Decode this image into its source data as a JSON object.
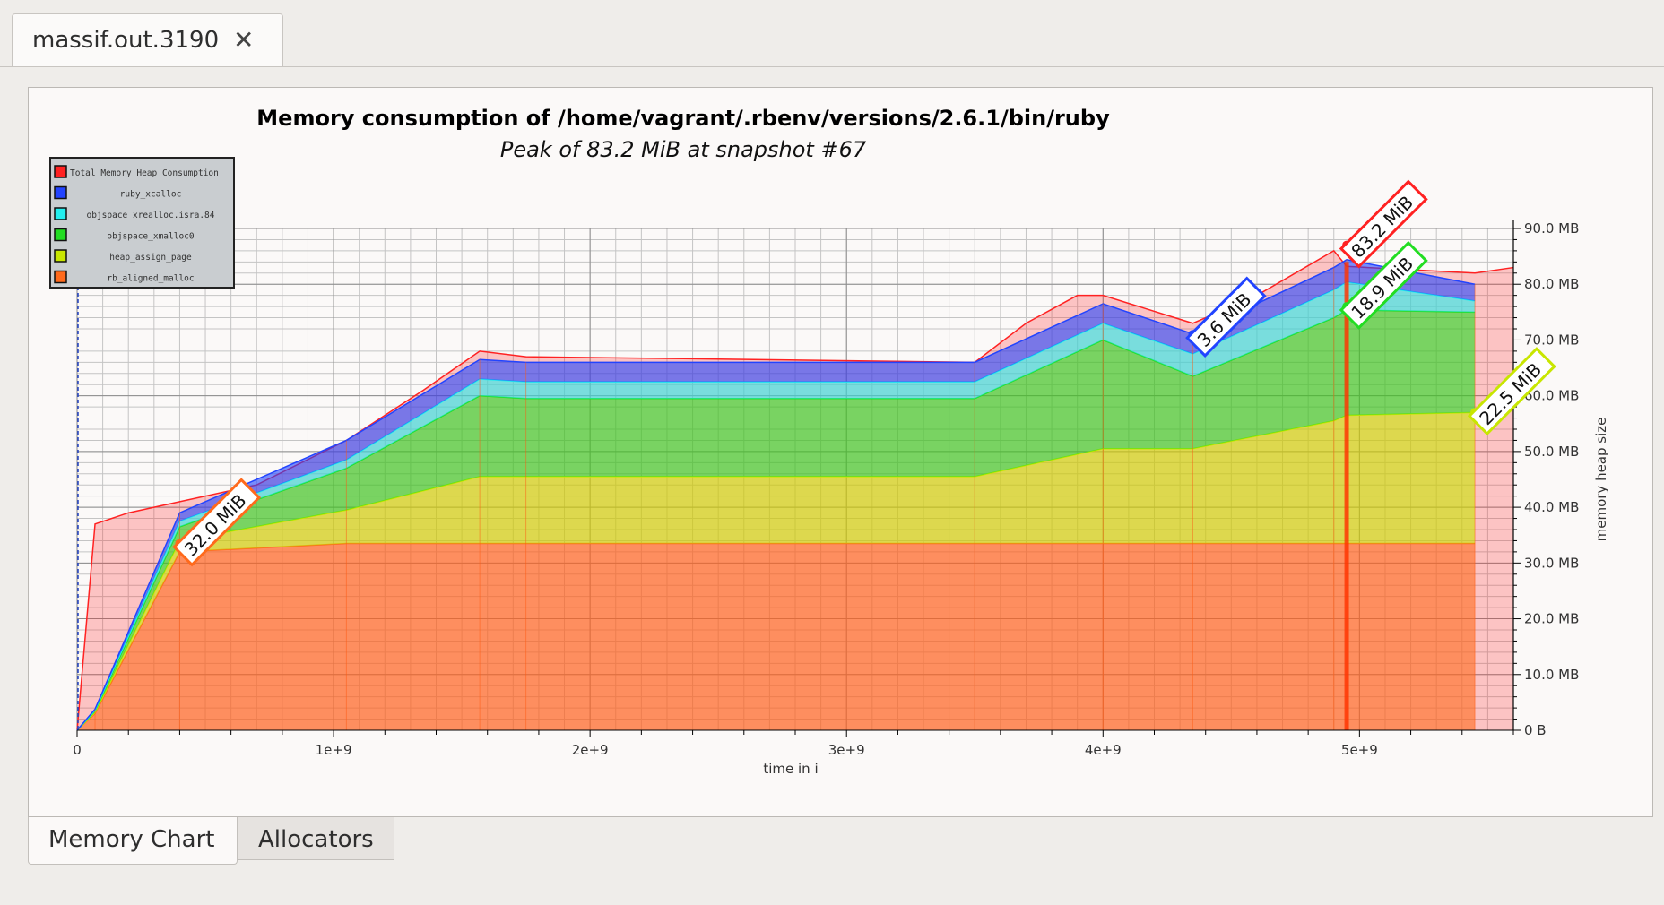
{
  "document_tab": {
    "label": "massif.out.3190",
    "close_glyph": "✕"
  },
  "view_tabs": [
    {
      "label": "Memory Chart",
      "active": true
    },
    {
      "label": "Allocators",
      "active": false
    }
  ],
  "chart_data": {
    "type": "area",
    "title": "Memory consumption of /home/vagrant/.rbenv/versions/2.6.1/bin/ruby",
    "subtitle": "Peak of 83.2 MiB at snapshot #67",
    "xlabel": "time in i",
    "ylabel": "memory heap size",
    "xlim": [
      0,
      5600000000.0
    ],
    "ylim": [
      0,
      90
    ],
    "x_ticks": [
      "0",
      "1e+9",
      "2e+9",
      "3e+9",
      "4e+9",
      "5e+9"
    ],
    "y_ticks": [
      "0 B",
      "10.0 MB",
      "20.0 MB",
      "30.0 MB",
      "40.0 MB",
      "50.0 MB",
      "60.0 MB",
      "70.0 MB",
      "80.0 MB",
      "90.0 MB"
    ],
    "grid": true,
    "legend_position": "top-left",
    "stacked": true,
    "x": [
      0,
      70000000.0,
      400000000.0,
      1050000000.0,
      1570000000.0,
      1750000000.0,
      3500000000.0,
      4000000000.0,
      4350000000.0,
      4900000000.0,
      4950000000.0,
      5450000000.0
    ],
    "series": [
      {
        "name": "rb_aligned_malloc",
        "color": "#ff6a1c",
        "values": [
          0,
          3,
          32.0,
          33.5,
          33.5,
          33.5,
          33.5,
          33.5,
          33.5,
          33.5,
          33.5,
          33.5
        ]
      },
      {
        "name": "heap_assign_page",
        "color": "#c8e600",
        "values": [
          0,
          0.2,
          2.0,
          6.0,
          12.0,
          12.0,
          12.0,
          17.0,
          17.0,
          22.0,
          23.0,
          23.5
        ]
      },
      {
        "name": "objspace_xmalloc0",
        "color": "#22dd22",
        "values": [
          0,
          0.3,
          2.5,
          7.5,
          14.5,
          14.0,
          14.0,
          19.5,
          13.0,
          18.5,
          18.9,
          18.0
        ]
      },
      {
        "name": "objspace_xrealloc.isra.84",
        "color": "#22eeee",
        "values": [
          0,
          0.1,
          1.0,
          1.5,
          3.0,
          3.0,
          3.0,
          3.0,
          4.0,
          5.0,
          5.0,
          2.0
        ]
      },
      {
        "name": "ruby_xcalloc",
        "color": "#2244ff",
        "values": [
          0,
          0.2,
          1.5,
          3.5,
          3.5,
          3.5,
          3.5,
          3.5,
          3.6,
          4.0,
          4.0,
          3.0
        ]
      }
    ],
    "total": {
      "name": "Total Memory Heap Consumption",
      "color": "#ff2222",
      "x": [
        0,
        70000000.0,
        200000000.0,
        400000000.0,
        700000000.0,
        1050000000.0,
        1350000000.0,
        1570000000.0,
        1750000000.0,
        3500000000.0,
        3700000000.0,
        3900000000.0,
        4000000000.0,
        4350000000.0,
        4600000000.0,
        4900000000.0,
        4950000000.0,
        5450000000.0,
        5600000000.0
      ],
      "values": [
        0,
        37,
        39,
        41,
        44,
        52,
        61,
        68,
        67,
        66,
        73,
        78,
        78,
        73,
        78,
        86,
        83.2,
        82,
        83
      ]
    },
    "annotations": [
      {
        "text": "32.0 MiB",
        "x": 400000000.0,
        "y": 33.5,
        "color": "#ff6a1c"
      },
      {
        "text": "3.6 MiB",
        "x": 4350000000.0,
        "y": 71,
        "color": "#2244ff"
      },
      {
        "text": "83.2 MiB",
        "x": 4950000000.0,
        "y": 87,
        "color": "#ff2222"
      },
      {
        "text": "18.9 MiB",
        "x": 4950000000.0,
        "y": 76,
        "color": "#22dd22"
      },
      {
        "text": "22.5 MiB",
        "x": 5450000000.0,
        "y": 57,
        "color": "#c8e600"
      }
    ]
  }
}
